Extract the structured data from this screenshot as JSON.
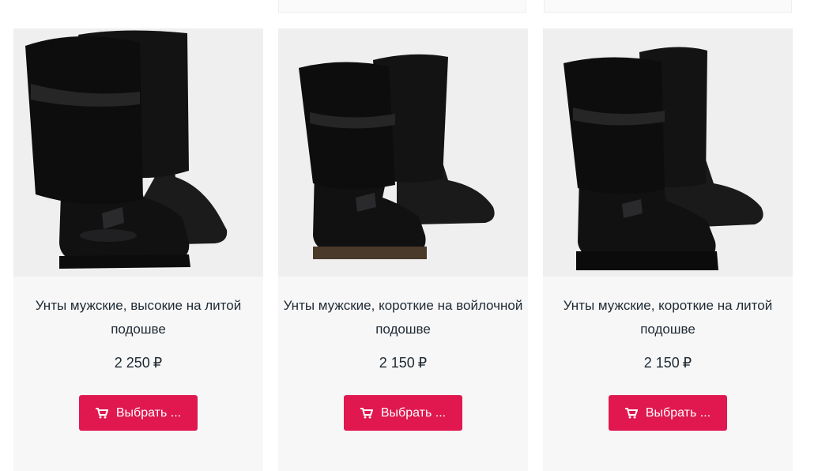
{
  "products": [
    {
      "title": "Унты мужские, высокие на литой подошве",
      "price": "2 250",
      "currency": "₽",
      "button_label": "Выбрать ...",
      "image_icon": "tall-fur-boots-image"
    },
    {
      "title": "Унты мужские, короткие на войлочной подошве",
      "price": "2 150",
      "currency": "₽",
      "button_label": "Выбрать ...",
      "image_icon": "short-fur-boots-felt-sole-image"
    },
    {
      "title": "Унты мужские, короткие на литой подошве",
      "price": "2 150",
      "currency": "₽",
      "button_label": "Выбрать ...",
      "image_icon": "short-fur-boots-cast-sole-image"
    }
  ],
  "colors": {
    "button_bg": "#e0184f",
    "card_bg": "#f7f7f8",
    "text": "#1f2a33"
  },
  "icons": {
    "cart": "shopping-cart-icon"
  }
}
